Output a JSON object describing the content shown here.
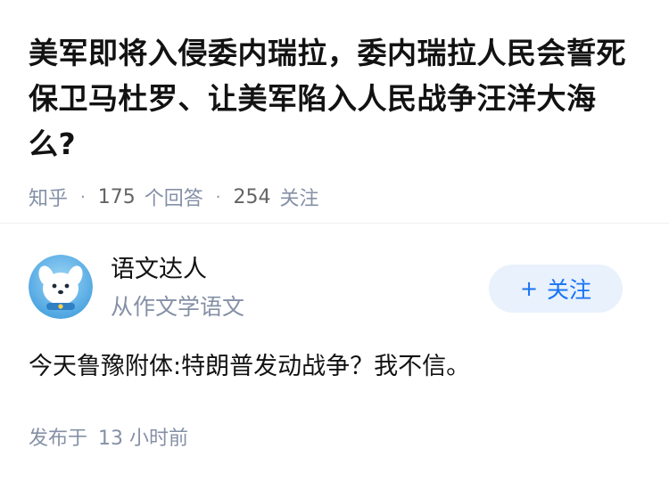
{
  "question": {
    "title": "美军即将入侵委内瑞拉，委内瑞拉人民会誓死保卫马杜罗、让美军陷入人民战争汪洋大海么?",
    "source": "知乎",
    "answer_count": "175",
    "answer_label": "个回答",
    "follower_count": "254",
    "follower_label": "关注"
  },
  "author": {
    "name": "语文达人",
    "bio": "从作文学语文",
    "avatar_icon": "dog-mascot-avatar-icon",
    "follow_label": "关注"
  },
  "answer": {
    "text": "今天鲁豫附体:特朗普发动战争？我不信。",
    "published_prefix": "发布于",
    "published_time": "13 小时前"
  },
  "colors": {
    "accent": "#1772f6",
    "follow_bg": "#e8f1fc",
    "meta": "#8590a6",
    "text": "#121212"
  }
}
